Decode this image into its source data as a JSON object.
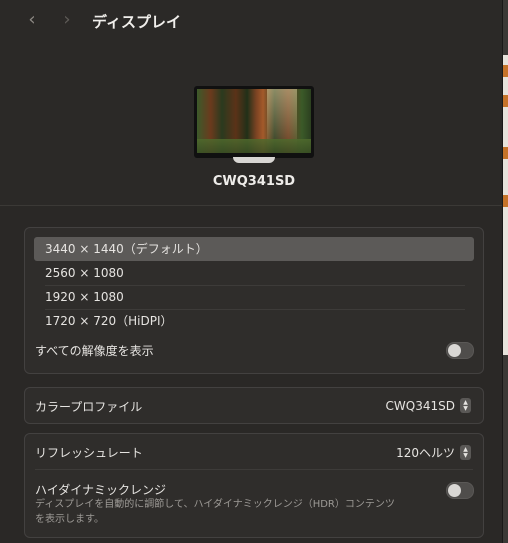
{
  "colors": {
    "window_bg": "#2a2826",
    "panel_bg": "#2f2d2b",
    "selected_row": "#5c5a58",
    "text": "#e6e4e1"
  },
  "toolbar": {
    "back_icon": "chevron-left-icon",
    "back_glyph": "‹",
    "forward_icon": "chevron-right-icon",
    "forward_glyph": "›",
    "title": "ディスプレイ"
  },
  "display": {
    "name": "CWQ341SD",
    "preview_icon": "monitor-icon"
  },
  "resolutions": {
    "items": [
      {
        "label": "3440 × 1440（デフォルト）",
        "selected": true
      },
      {
        "label": "2560 × 1080",
        "selected": false
      },
      {
        "label": "1920 × 1080",
        "selected": false
      },
      {
        "label": "1720 × 720（HiDPI）",
        "selected": false
      }
    ],
    "show_all_label": "すべての解像度を表示",
    "show_all_enabled": false
  },
  "color_profile": {
    "label": "カラープロファイル",
    "value": "CWQ341SD"
  },
  "refresh_rate": {
    "label": "リフレッシュレート",
    "value": "120ヘルツ"
  },
  "hdr": {
    "label": "ハイダイナミックレンジ",
    "description_line1": "ディスプレイを自動的に調節して、ハイダイナミックレンジ（HDR）コンテンツ",
    "description_line2": "を表示します。",
    "enabled": false
  }
}
